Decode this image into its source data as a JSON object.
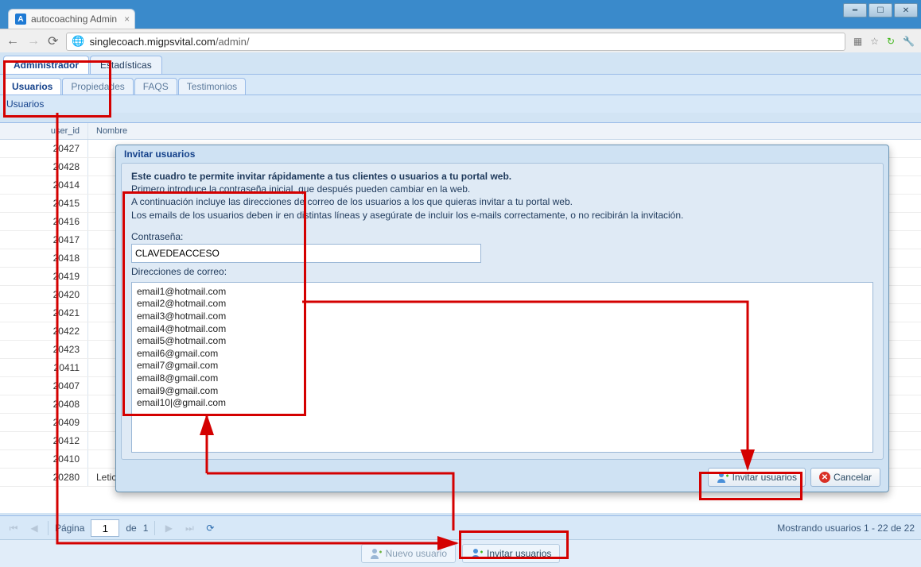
{
  "window": {
    "tab_title": "autocoaching Admin"
  },
  "url": {
    "secure_prefix": "",
    "domain": "singlecoach.migpsvital.com",
    "path": "/admin/"
  },
  "topTabs": {
    "admin": "Administrador",
    "stats": "Estadísticas"
  },
  "subTabs": {
    "users": "Usuarios",
    "props": "Propiedades",
    "faqs": "FAQS",
    "test": "Testimonios"
  },
  "panel": {
    "title": "Usuarios"
  },
  "grid": {
    "columns": {
      "id": "user_id",
      "name": "Nombre"
    },
    "rows": [
      {
        "id": "20427",
        "name": ""
      },
      {
        "id": "20428",
        "name": ""
      },
      {
        "id": "20414",
        "name": ""
      },
      {
        "id": "20415",
        "name": ""
      },
      {
        "id": "20416",
        "name": ""
      },
      {
        "id": "20417",
        "name": ""
      },
      {
        "id": "20418",
        "name": ""
      },
      {
        "id": "20419",
        "name": ""
      },
      {
        "id": "20420",
        "name": ""
      },
      {
        "id": "20421",
        "name": ""
      },
      {
        "id": "20422",
        "name": ""
      },
      {
        "id": "20423",
        "name": ""
      },
      {
        "id": "20411",
        "name": ""
      },
      {
        "id": "20407",
        "name": ""
      },
      {
        "id": "20408",
        "name": ""
      },
      {
        "id": "20409",
        "name": ""
      },
      {
        "id": "20412",
        "name": ""
      },
      {
        "id": "20410",
        "name": ""
      },
      {
        "id": "20280",
        "name": "Leticia"
      }
    ]
  },
  "paging": {
    "page_label": "Página",
    "of_label": "de",
    "page": "1",
    "total": "1",
    "status": "Mostrando usuarios 1 - 22 de 22"
  },
  "toolbar": {
    "new_user": "Nuevo usuario",
    "invite_users": "Invitar usuarios"
  },
  "dialog": {
    "title": "Invitar usuarios",
    "intro_bold": "Este cuadro te permite invitar rápidamente a tus clientes o usuarios a tu portal web.",
    "intro_l1": "Primero introduce la contraseña inicial, que después pueden cambiar en la web.",
    "intro_l2": "A continuación incluye las direcciones de correo de los usuarios a los que quieras invitar a tu portal web.",
    "intro_l3": "Los emails de los usuarios deben ir en distintas líneas y asegúrate de incluir los e-mails correctamente, o no recibirán la invitación.",
    "password_label": "Contraseña:",
    "password_value": "CLAVEDEACCESO",
    "emails_label": "Direcciones de correo:",
    "emails_value": "email1@hotmail.com\nemail2@hotmail.com\nemail3@hotmail.com\nemail4@hotmail.com\nemail5@hotmail.com\nemail6@gmail.com\nemail7@gmail.com\nemail8@gmail.com\nemail9@gmail.com\nemail10|@gmail.com",
    "invite_btn": "Invitar usuarios",
    "cancel_btn": "Cancelar"
  }
}
